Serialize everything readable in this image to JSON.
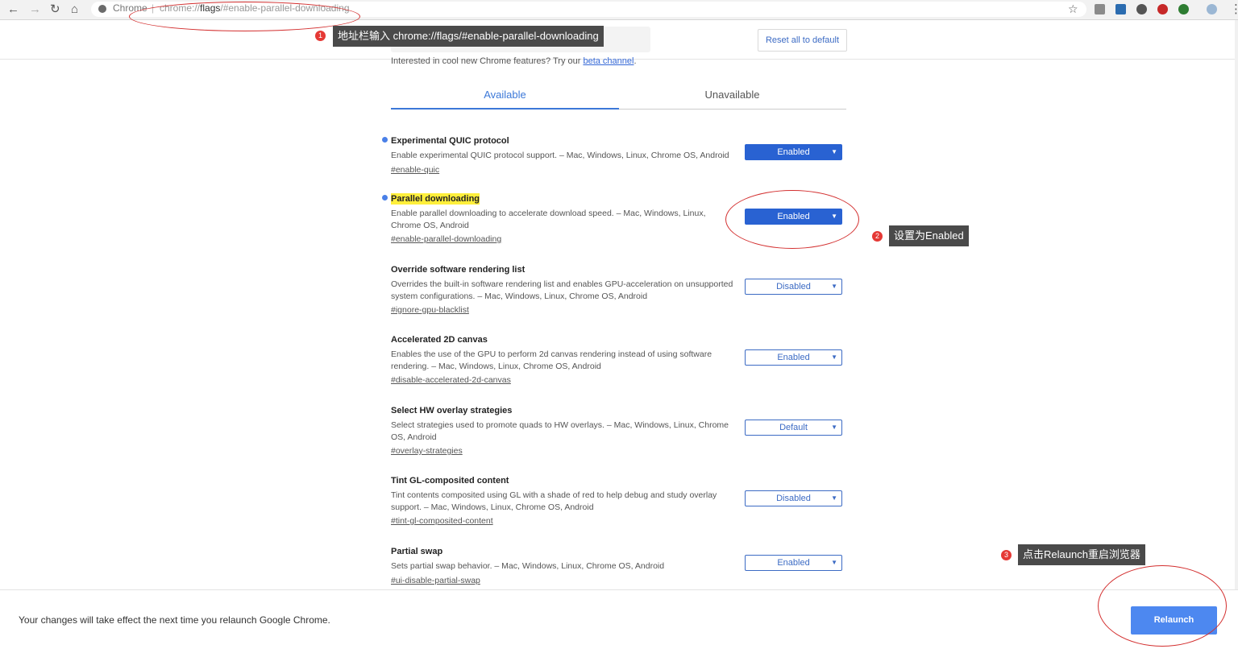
{
  "browser": {
    "site_name": "Chrome",
    "url_prefix": "chrome://",
    "url_host": "flags",
    "url_rest": "/#enable-parallel-downloading",
    "separator": "|"
  },
  "header": {
    "reset_label": "Reset all to default",
    "intro_text": "Interested in cool new Chrome features? Try our ",
    "intro_link": "beta channel",
    "intro_end": "."
  },
  "tabs": {
    "available": "Available",
    "unavailable": "Unavailable"
  },
  "flags": [
    {
      "title": "Experimental QUIC protocol",
      "desc": "Enable experimental QUIC protocol support. – Mac, Windows, Linux, Chrome OS, Android",
      "link": "#enable-quic",
      "value": "Enabled"
    },
    {
      "title": "Parallel downloading",
      "desc": "Enable parallel downloading to accelerate download speed. – Mac, Windows, Linux, Chrome OS, Android",
      "link": "#enable-parallel-downloading",
      "value": "Enabled"
    },
    {
      "title": "Override software rendering list",
      "desc": "Overrides the built-in software rendering list and enables GPU-acceleration on unsupported system configurations. – Mac, Windows, Linux, Chrome OS, Android",
      "link": "#ignore-gpu-blacklist",
      "value": "Disabled"
    },
    {
      "title": "Accelerated 2D canvas",
      "desc": "Enables the use of the GPU to perform 2d canvas rendering instead of using software rendering. – Mac, Windows, Linux, Chrome OS, Android",
      "link": "#disable-accelerated-2d-canvas",
      "value": "Enabled"
    },
    {
      "title": "Select HW overlay strategies",
      "desc": "Select strategies used to promote quads to HW overlays. – Mac, Windows, Linux, Chrome OS, Android",
      "link": "#overlay-strategies",
      "value": "Default"
    },
    {
      "title": "Tint GL-composited content",
      "desc": "Tint contents composited using GL with a shade of red to help debug and study overlay support. – Mac, Windows, Linux, Chrome OS, Android",
      "link": "#tint-gl-composited-content",
      "value": "Disabled"
    },
    {
      "title": "Partial swap",
      "desc": "Sets partial swap behavior. – Mac, Windows, Linux, Chrome OS, Android",
      "link": "#ui-disable-partial-swap",
      "value": "Enabled"
    }
  ],
  "footer": {
    "message": "Your changes will take effect the next time you relaunch Google Chrome.",
    "relaunch_label": "Relaunch"
  },
  "annotations": [
    {
      "num": "1",
      "text": "地址栏输入 chrome://flags/#enable-parallel-downloading"
    },
    {
      "num": "2",
      "text": "设置为Enabled"
    },
    {
      "num": "3",
      "text": "点击Relaunch重启浏览器"
    }
  ],
  "icons": {
    "back": "back-arrow-icon",
    "forward": "forward-arrow-icon",
    "reload": "reload-icon",
    "home": "home-icon",
    "star": "bookmark-star-icon",
    "dropdown": "dropdown-arrow-icon"
  }
}
